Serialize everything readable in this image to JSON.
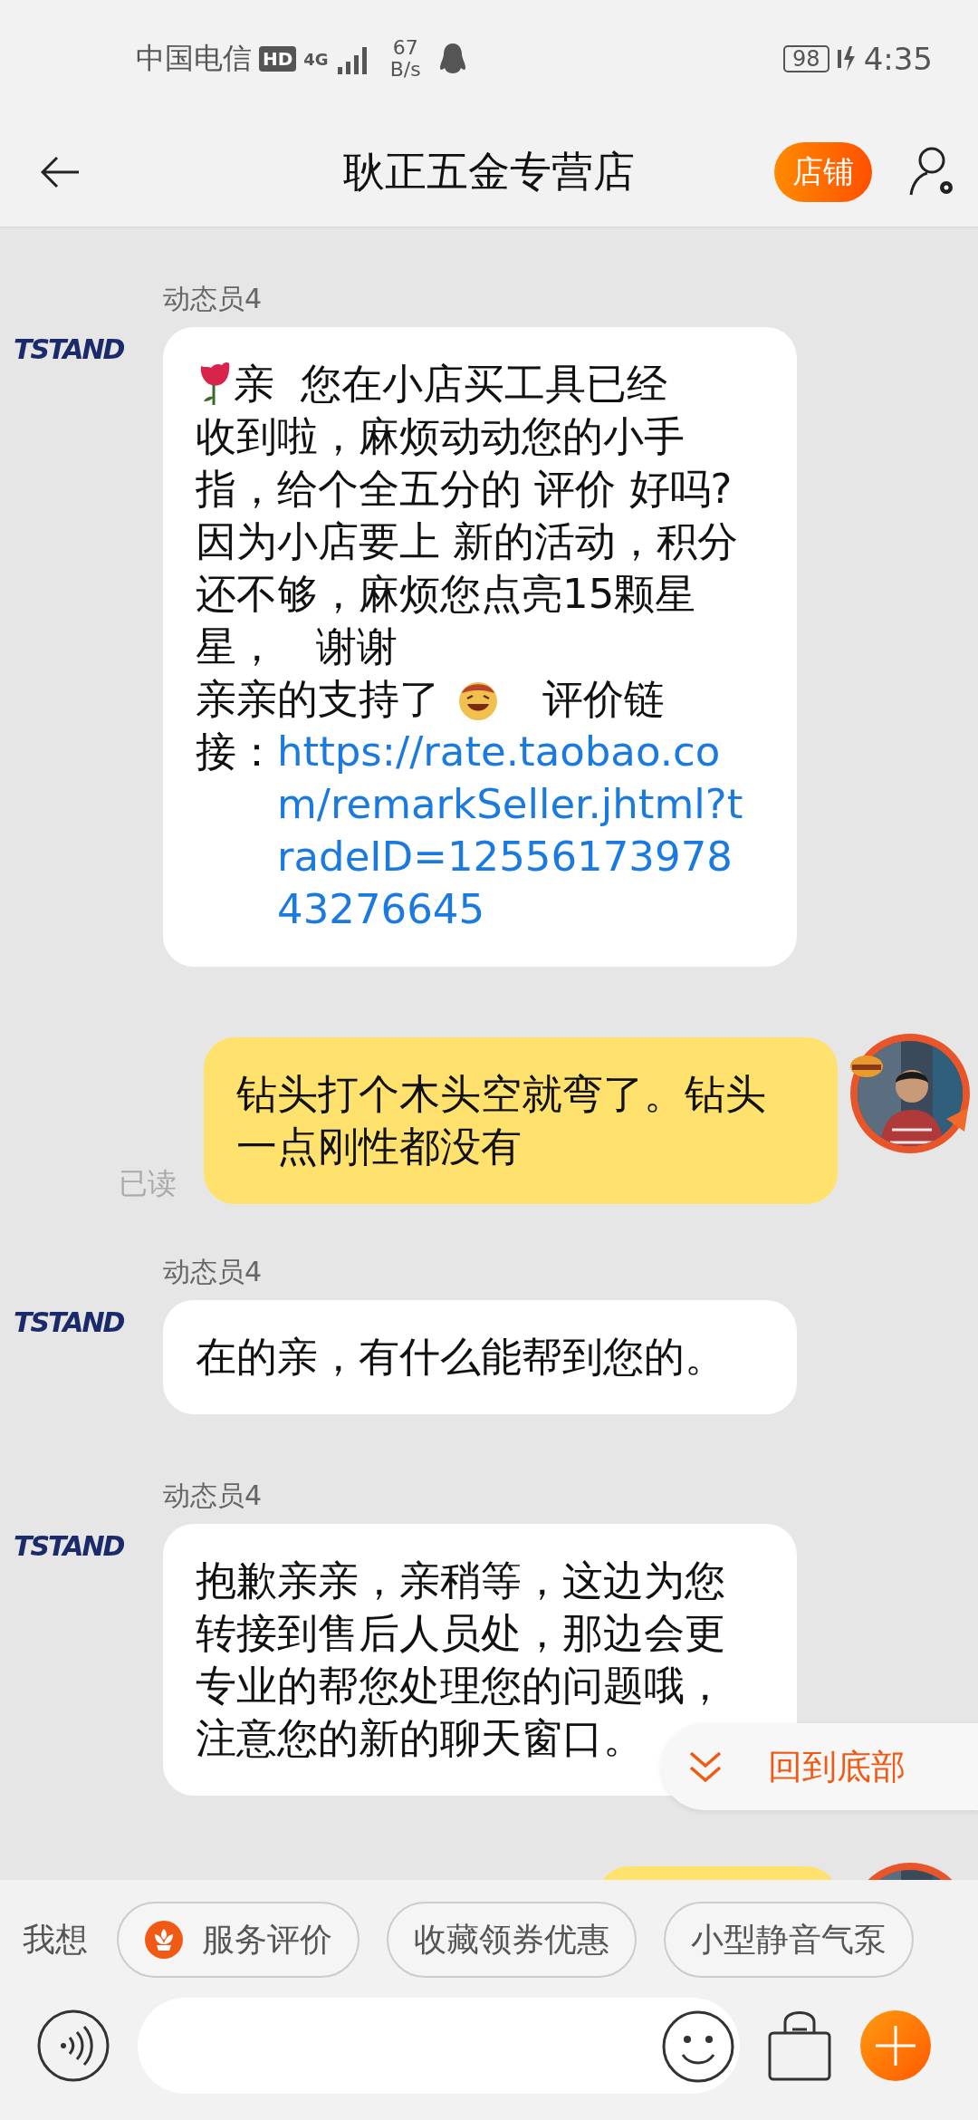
{
  "status_bar": {
    "carrier": "中国电信",
    "hd": "HD",
    "network": "4G",
    "speed_value": "67",
    "speed_unit": "B/s",
    "battery": "98",
    "time": "4:35"
  },
  "header": {
    "title": "耿正五金专营店",
    "shop_button": "店铺"
  },
  "messages": [
    {
      "kind": "received",
      "sender": "动态员4",
      "avatar_logo": "TSTAND",
      "lines": [
        [
          {
            "kind": "rose"
          },
          {
            "kind": "text",
            "text": "亲  您在小店买工具已经"
          }
        ],
        [
          {
            "kind": "text",
            "text": "收到啦，麻烦动动您的小手指，给个全五分的 评价 好吗?          因为小店要上 新的活动，积分还不够，麻烦您点亮15颗星星，   谢谢"
          }
        ],
        [
          {
            "kind": "text",
            "text": "亲亲的支持了 "
          },
          {
            "kind": "emoji"
          },
          {
            "kind": "text",
            "text": "   评价链"
          }
        ],
        [
          {
            "kind": "text",
            "text": "接："
          },
          {
            "kind": "link",
            "text": "https://rate.taobao.com/remarkSeller.jhtml?tradeID=1255617397843276645"
          }
        ]
      ]
    },
    {
      "kind": "sent",
      "status": "已读",
      "text": "钻头打个木头空就弯了。钻头一点刚性都没有"
    },
    {
      "kind": "received",
      "sender": "动态员4",
      "avatar_logo": "TSTAND",
      "lines": [
        [
          {
            "kind": "text",
            "text": "在的亲，有什么能帮到您的。"
          }
        ]
      ]
    },
    {
      "kind": "received",
      "sender": "动态员4",
      "avatar_logo": "TSTAND",
      "lines": [
        [
          {
            "kind": "text",
            "text": "抱歉亲亲，亲稍等，这边为您转接到售后人员处，那边会更专业的帮您处理您的问题哦，注意您的新的聊天窗口。"
          }
        ]
      ]
    },
    {
      "kind": "sent"
    }
  ],
  "scroll_to_bottom": "回到底部",
  "quick_replies": {
    "label": "我想",
    "chips": [
      {
        "kind": "with_icon",
        "text": "服务评价"
      },
      {
        "kind": "plain",
        "text": "收藏领券优惠"
      },
      {
        "kind": "plain",
        "text": "小型静音气泵"
      }
    ]
  }
}
